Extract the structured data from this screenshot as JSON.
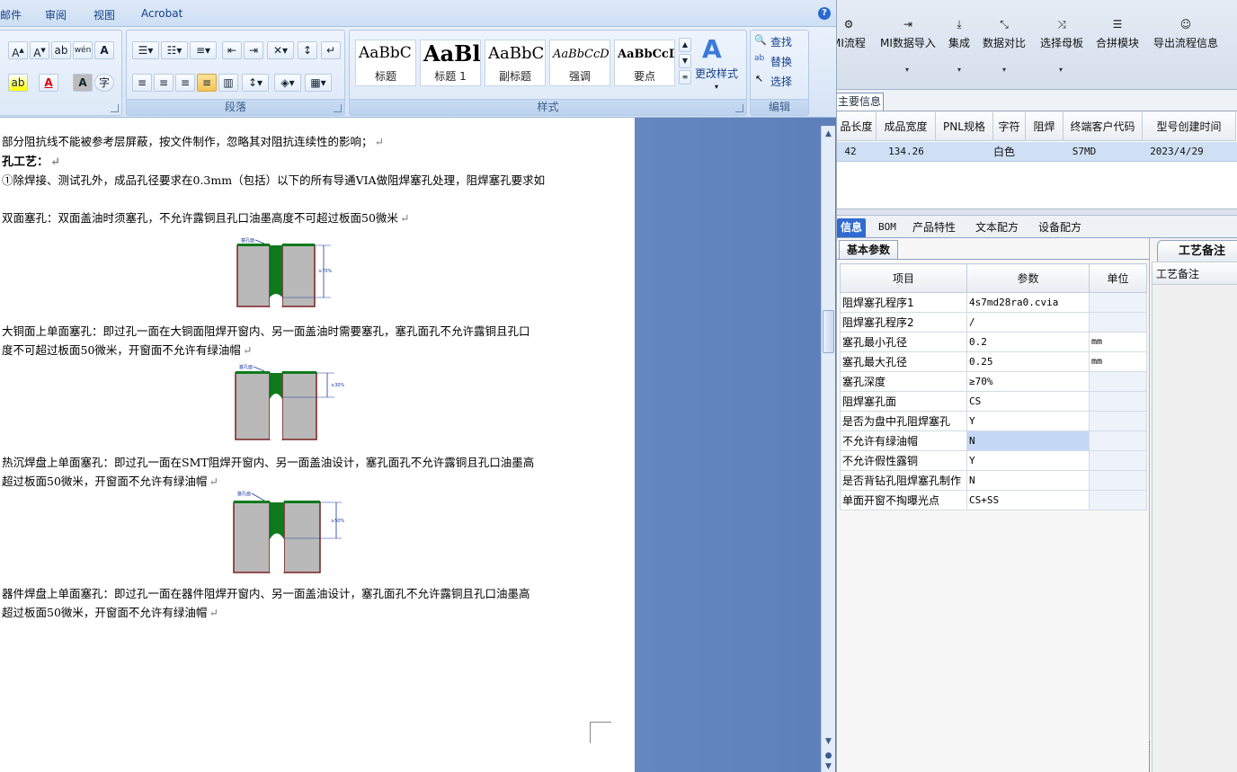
{
  "word": {
    "menu": [
      "邮件",
      "审阅",
      "视图",
      "Acrobat"
    ],
    "ribbon": {
      "groups": {
        "paragraph": "段落",
        "styles": "样式",
        "editing": "编辑"
      },
      "styles": [
        {
          "sample": "AaBbC",
          "name": "标题"
        },
        {
          "sample": "AaBl",
          "name": "标题 1"
        },
        {
          "sample": "AaBbC",
          "name": "副标题"
        },
        {
          "sample": "AaBbCcD",
          "name": "强调"
        },
        {
          "sample": "AaBbCcD",
          "name": "要点"
        }
      ],
      "change_styles": "更改样式",
      "find": "查找",
      "replace": "替换",
      "select": "选择"
    },
    "doc": {
      "lines": [
        "部分阻抗线不能被参考层屏蔽，按文件制作，忽略其对阻抗连续性的影响；",
        "孔工艺：",
        "①除焊接、测试孔外，成品孔径要求在0.3mm（包括）以下的所有导通VIA做阻焊塞孔处理，阻焊塞孔要求如",
        "双面塞孔：双面盖油时须塞孔，不允许露铜且孔口油墨高度不可超过板面50微米",
        "大铜面上单面塞孔：即过孔一面在大铜面阻焊开窗内、另一面盖油时需要塞孔，塞孔面孔不允许露铜且孔口",
        "度不可超过板面50微米，开窗面不允许有绿油帽",
        "热沉焊盘上单面塞孔：即过孔一面在SMT阻焊开窗内、另一面盖油设计，塞孔面孔不允许露铜且孔口油墨高",
        "超过板面50微米，开窗面不允许有绿油帽",
        "器件焊盘上单面塞孔：即过孔一面在器件阻焊开窗内、另一面盖油设计，塞孔面孔不允许露铜且孔口油墨高",
        "超过板面50微米，开窗面不允许有绿油帽"
      ],
      "figures": [
        {
          "label": "塞孔面",
          "depth": "≥70%",
          "fill": 0.7
        },
        {
          "label": "塞孔面",
          "depth": "≥30%",
          "fill": 0.3
        },
        {
          "label": "塞孔面",
          "depth": "≥50%",
          "fill": 0.5
        }
      ]
    }
  },
  "app": {
    "toolbar": [
      "MI流程",
      "MI数据导入",
      "集成",
      "数据对比",
      "选择母板",
      "合拼模块",
      "导出流程信息"
    ],
    "main_tab": "主要信息",
    "grid": {
      "headers": [
        "品长度",
        "成品宽度",
        "PNL规格",
        "字符",
        "阻焊",
        "终端客户代码",
        "型号创建时间"
      ],
      "row": [
        "42",
        "134.26",
        "",
        "白色",
        "",
        "S7MD",
        "2023/4/29"
      ]
    },
    "subtabs": [
      "信息",
      "BOM",
      "产品特性",
      "文本配方",
      "设备配方"
    ],
    "basic": {
      "tab": "基本参数",
      "headers": {
        "item": "项目",
        "param": "参数",
        "unit": "单位"
      },
      "rows": [
        {
          "item": "阻焊塞孔程序1",
          "param": "4s7md28ra0.cvia",
          "unit": ""
        },
        {
          "item": "阻焊塞孔程序2",
          "param": "/",
          "unit": ""
        },
        {
          "item": "塞孔最小孔径",
          "param": "0.2",
          "unit": "mm"
        },
        {
          "item": "塞孔最大孔径",
          "param": "0.25",
          "unit": "mm"
        },
        {
          "item": "塞孔深度",
          "param": "≥70%",
          "unit": ""
        },
        {
          "item": "阻焊塞孔面",
          "param": "CS",
          "unit": ""
        },
        {
          "item": "是否为盘中孔阻焊塞孔",
          "param": "Y",
          "unit": ""
        },
        {
          "item": "不允许有绿油帽",
          "param": "N",
          "unit": ""
        },
        {
          "item": "不允许假性露铜",
          "param": "Y",
          "unit": ""
        },
        {
          "item": "是否背钻孔阻焊塞孔制作",
          "param": "N",
          "unit": ""
        },
        {
          "item": "单面开窗不掏曝光点",
          "param": "CS+SS",
          "unit": ""
        }
      ]
    },
    "remark": {
      "tab": "工艺备注",
      "header": "工艺备注"
    }
  }
}
